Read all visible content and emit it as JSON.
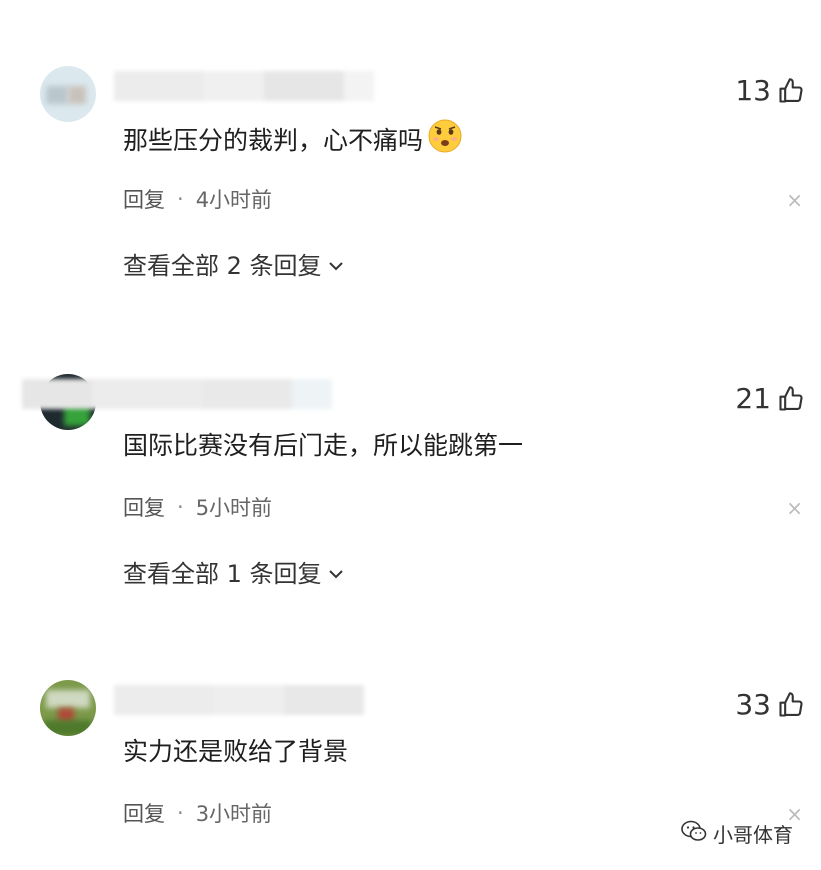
{
  "comments": [
    {
      "likes": "13",
      "text": "那些压分的裁判，心不痛吗",
      "has_emoji": true,
      "reply_label": "回复",
      "dot": "·",
      "time": "4小时前",
      "view_all": "查看全部 2 条回复"
    },
    {
      "likes": "21",
      "text": "国际比赛没有后门走，所以能跳第一",
      "has_emoji": false,
      "reply_label": "回复",
      "dot": "·",
      "time": "5小时前",
      "view_all": "查看全部 1 条回复"
    },
    {
      "likes": "33",
      "text": "实力还是败给了背景",
      "has_emoji": false,
      "reply_label": "回复",
      "dot": "·",
      "time": "3小时前",
      "view_all": ""
    }
  ],
  "close_glyph": "×",
  "watermark": {
    "text": "小哥体育",
    "icon": "wechat-icon"
  },
  "icons": {
    "like": "thumbs-up-icon",
    "chevron": "chevron-down-icon",
    "close": "close-icon",
    "emoji": "sad-face-emoji"
  },
  "colors": {
    "text": "#1f1f1f",
    "meta": "#555555",
    "close": "#bbbbbb"
  }
}
